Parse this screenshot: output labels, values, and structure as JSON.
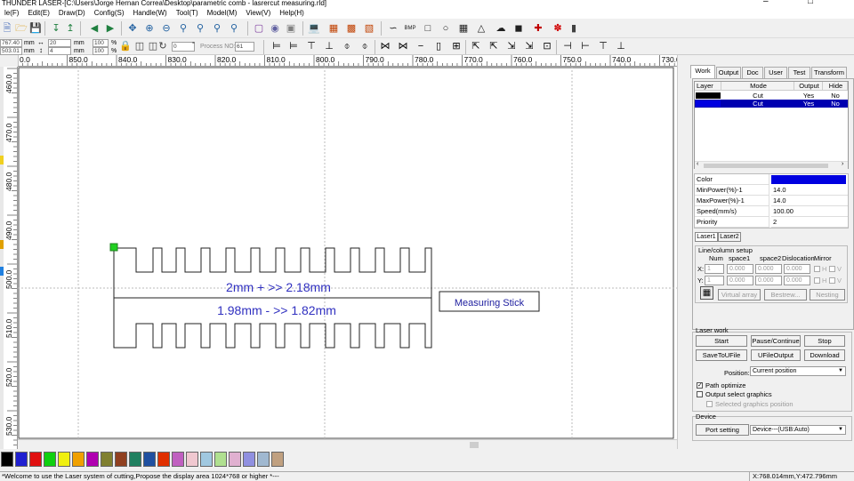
{
  "window": {
    "title": "THUNDER LASER-[C:\\Users\\Jorge Hernan Correa\\Desktop\\parametric comb - lasrercut measuring.rld]"
  },
  "menu": [
    "le(F)",
    "Edit(E)",
    "Draw(D)",
    "Config(S)",
    "Handle(W)",
    "Tool(T)",
    "Model(M)",
    "View(V)",
    "Help(H)"
  ],
  "toolbar2": {
    "x_value": "767.40",
    "y_value": "503.01",
    "unit1": "mm",
    "unit2": "mm",
    "w_value": "20",
    "h_value": "4",
    "w_unit": "mm",
    "h_unit": "mm",
    "sx_value": "100",
    "sy_value": "100",
    "pct1": "%",
    "pct2": "%",
    "angle_value": "0",
    "angle_unit": "°",
    "process_label": "Process NO:",
    "process_value": "61"
  },
  "ruler_top": {
    "labels": [
      "0.0",
      "850.0",
      "840.0",
      "830.0",
      "820.0",
      "810.0",
      "800.0",
      "790.0",
      "780.0",
      "770.0",
      "760.0",
      "750.0",
      "740.0",
      "730.0"
    ]
  },
  "ruler_left": {
    "labels": [
      "460.0",
      "470.0",
      "480.0",
      "490.0",
      "500.0",
      "510.0",
      "520.0",
      "530.0"
    ]
  },
  "canvas": {
    "text1": "2mm + >> 2.18mm",
    "text2": "1.98mm - >> 1.82mm",
    "label_box": "Measuring Stick",
    "text_color": "#3030c0"
  },
  "palette": [
    "#000000",
    "#2020d0",
    "#e01010",
    "#10d010",
    "#f0f010",
    "#f0a000",
    "#b000b0",
    "#808030",
    "#904020",
    "#208060",
    "#2050a0",
    "#e03000",
    "#c060c0",
    "#f0c8d0",
    "#a0c8e0",
    "#b0e090",
    "#e0b0d0",
    "#9090e0",
    "#a0b8d0",
    "#c0a080"
  ],
  "status": {
    "message": "*Welcome to use the Laser system of cutting,Propose the display area 1024*768 or higher *---",
    "coords": "X:768.014mm,Y:472.796mm"
  },
  "panel": {
    "tabs": [
      "Work",
      "Output",
      "Doc",
      "User",
      "Test",
      "Transform"
    ],
    "layer_headers": [
      "Layer",
      "Mode",
      "Output",
      "Hide"
    ],
    "layers": [
      {
        "color": "#000000",
        "mode": "Cut",
        "output": "Yes",
        "hide": "No",
        "selected": false
      },
      {
        "color": "#0000e0",
        "mode": "Cut",
        "output": "Yes",
        "hide": "No",
        "selected": true
      }
    ],
    "props": [
      {
        "label": "Color",
        "value": ""
      },
      {
        "label": "MinPower(%)-1",
        "value": "14.0"
      },
      {
        "label": "MaxPower(%)-1",
        "value": "14.0"
      },
      {
        "label": "Speed(mm/s)",
        "value": "100.00"
      },
      {
        "label": "Priority",
        "value": "2"
      }
    ],
    "prop_color": "#0000e0",
    "laser_tabs": [
      "Laser1",
      "Laser2"
    ],
    "array_group": "Line/column setup",
    "array_headers": [
      "Num",
      "space1",
      "space2",
      "Dislocation",
      "Mirror"
    ],
    "row_x": {
      "label": "X:",
      "num": "1",
      "s1": "0.000",
      "s2": "0.000",
      "dis": "0.000",
      "h": "H",
      "v": "V"
    },
    "row_y": {
      "label": "Y:",
      "num": "1",
      "s1": "0.000",
      "s2": "0.000",
      "dis": "0.000",
      "h": "H",
      "v": "V"
    },
    "array_buttons": [
      "Virtual array",
      "Bestrew...",
      "Nesting"
    ],
    "laser_work": "Laser work",
    "work_buttons": [
      "Start",
      "Pause/Continue",
      "Stop",
      "SaveToUFile",
      "UFileOutput",
      "Download"
    ],
    "position_label": "Position:",
    "position_value": "Current position",
    "path_optimize": "Path optimize",
    "output_select": "Output select graphics",
    "selected_pos": "Selected graphics position",
    "device_group": "Device",
    "port_setting": "Port setting",
    "device_value": "Device---(USB:Auto)"
  }
}
